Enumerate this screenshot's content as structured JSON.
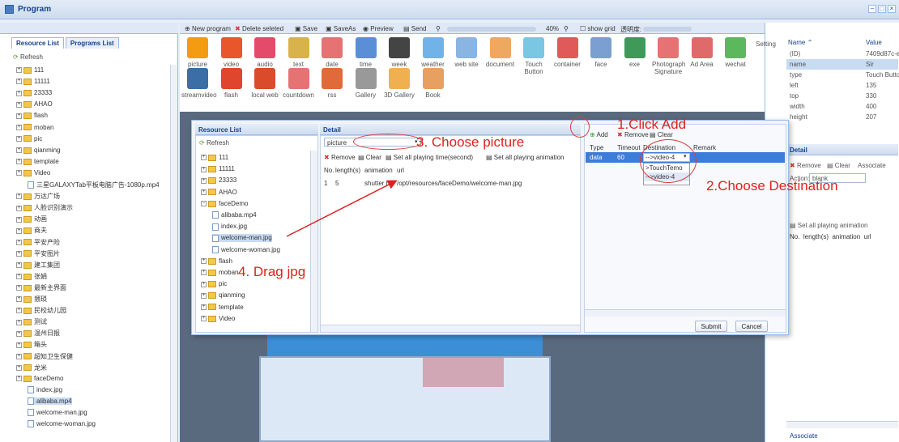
{
  "window": {
    "title": "Program"
  },
  "left": {
    "tabs": [
      "Resource List",
      "Programs List"
    ],
    "refresh": "Refresh",
    "tree": [
      "111",
      "11111",
      "23333",
      "AHAO",
      "flash",
      "moban",
      "pic",
      "qianming",
      "template",
      "Video",
      "三星GALAXYTab平板电脑广告-1080p.mp4",
      "万达广场",
      "人脸识别演示",
      "动画",
      "商夫",
      "平安产险",
      "平安图片",
      "建工集团",
      "张娟",
      "最新主界面",
      "猥琐",
      "民校幼儿园",
      "测试",
      "温州日报",
      "箱头",
      "超知卫生保健",
      "龙米",
      "faceDemo",
      "index.jpg",
      "alibaba.mp4",
      "welcome-man.jpg",
      "welcome-woman.jpg"
    ]
  },
  "toolbar": {
    "new": "New program",
    "delete": "Delete seleted",
    "save": "Save",
    "saveas": "SaveAs",
    "preview": "Preview",
    "send": "Send",
    "zoom": "40%",
    "grid": "show grid",
    "opacity": "透明度:"
  },
  "palette": {
    "row1": [
      "picture",
      "video",
      "audio",
      "text",
      "date",
      "time",
      "week",
      "weather",
      "web site",
      "document",
      "Touch Button",
      "container",
      "face",
      "exe",
      "Photograph Signature",
      "Ad Area",
      "wechat"
    ],
    "row2": [
      "streamvideo",
      "flash",
      "local web",
      "countdown",
      "rss",
      "Gallery",
      "3D Gallery",
      "Book"
    ],
    "icons": {
      "date": "08",
      "time": "11:11",
      "week": "MON",
      "ad": "Ad",
      "text": "marquee"
    }
  },
  "props": {
    "setting": "Setting",
    "name_col": "Name ⌃",
    "value_col": "Value",
    "rows": [
      [
        "(ID)",
        "7409d87c-e..."
      ],
      [
        "name",
        "Sir"
      ],
      [
        "type",
        "Touch Button"
      ],
      [
        "left",
        "135"
      ],
      [
        "top",
        "330"
      ],
      [
        "width",
        "400"
      ],
      [
        "height",
        "207"
      ]
    ],
    "detail": "Detail",
    "remove": "Remove",
    "clear": "Clear",
    "associate": "Associate",
    "action_label": "Action:",
    "action_value": "blank",
    "set_anim": "Set all playing animation",
    "cols": [
      "No.",
      "length(s)",
      "animation",
      "url"
    ],
    "footer": "Associate"
  },
  "dialog": {
    "res_title": "Resource List",
    "res_refresh": "Refresh",
    "res_tree": [
      "111",
      "11111",
      "23333",
      "AHAO",
      "faceDemo",
      "alibaba.mp4",
      "index.jpg",
      "welcome-man.jpg",
      "welcome-woman.jpg",
      "flash",
      "moban",
      "pic",
      "qianming",
      "template",
      "Video"
    ],
    "detail_title": "Detail",
    "type_value": "picture",
    "remove": "Remove",
    "clear": "Clear",
    "set_time": "Set all playing time(second)",
    "set_anim": "Set all playing animation",
    "cols": [
      "No.",
      "length(s)",
      "animation",
      "url"
    ],
    "row": [
      "1",
      "5",
      "shutter h",
      "/opt/resources/faceDemo/welcome-man.jpg"
    ],
    "add": "Add",
    "rm2": "Remove",
    "clear2": "Clear",
    "tcols": [
      "Type",
      "Timeout",
      "Destination",
      "Remark"
    ],
    "trow": [
      "data",
      "60",
      "-->video-4"
    ],
    "options": [
      ">TouchTemo",
      "-->video-4"
    ],
    "submit": "Submit",
    "cancel": "Cancel"
  },
  "annotations": {
    "a1": "1.Click Add",
    "a2": "2.Choose Destination",
    "a3": "3. Choose picture",
    "a4": "4. Drag jpg"
  },
  "colors": {
    "accent": "#99bbe8",
    "annotation": "#e02020",
    "selected": "#c7dbf3"
  }
}
